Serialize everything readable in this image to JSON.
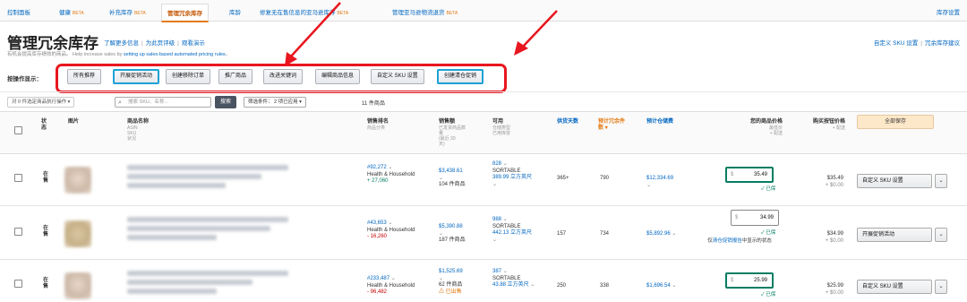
{
  "tabs": [
    {
      "label": "控制面板"
    },
    {
      "label": "健康",
      "badge": "BETA"
    },
    {
      "label": "补充库存",
      "badge": "BETA"
    },
    {
      "label": "管理冗余库存"
    },
    {
      "label": "库龄"
    },
    {
      "label": "修复无在售信息的亚马逊库存",
      "badge": "BETA"
    },
    {
      "label": "管理亚马逊物流退货",
      "badge": "BETA"
    }
  ],
  "tab_right": "库存设置",
  "header": {
    "title": "管理冗余库存",
    "links": [
      "了解更多信息",
      "为此页评级",
      "观看演示"
    ],
    "subtitle_prefix": "有机会提高库存绩效的商品。",
    "subtitle_mid": "Help increase sales by",
    "subtitle_link": "setting up sales-based automated pricing rules",
    "subtitle_end": "。",
    "right_links": [
      "自定义 SKU 设置",
      "冗余库存建议"
    ]
  },
  "actions": {
    "label": "按操作显示：",
    "buttons": [
      "所有推荐",
      "开展促销活动",
      "创建移除订单",
      "推广商品",
      "改进关键词",
      "编辑商品信息",
      "自定义 SKU 设置",
      "创建清仓促销"
    ]
  },
  "filters": {
    "selection": "对 0 件选定商品执行操作",
    "search_placeholder": "搜索 SKU、名称...",
    "search_button": "搜索",
    "condition": "筛选条件： 2 项已应用",
    "count": "11 件商品"
  },
  "table": {
    "save_all": "全部保存",
    "headers": {
      "status": "状态",
      "image": "图片",
      "name": "商品名称",
      "name_sub": [
        "ASIN",
        "SKU",
        "状况"
      ],
      "sales_rank": "销售排名",
      "sales_rank_sub": "商品分类",
      "sales": "销售额",
      "sales_sub": [
        "已发货商品数",
        "量",
        "(最近 30",
        "天)"
      ],
      "available": "可用",
      "available_sub": [
        "仓储类型",
        "已用库容"
      ],
      "days_supply": "供货天数",
      "est_excess": "预计冗余件数",
      "est_storage": "预计仓储费",
      "your_price": "您的商品价格",
      "your_price_sub": [
        "最低价",
        "+ 配送"
      ],
      "buybox": "购买按钮价格",
      "buybox_sub": "+ 配送"
    },
    "rows": [
      {
        "status": "在售",
        "rank": "#92,272",
        "category": "Health & Household",
        "rank_delta": "+ 27,060",
        "sales": "$3,438.61",
        "units": "104 件商品",
        "available": "828",
        "storage_type": "SORTABLE",
        "volume": "389.99 立方英尺",
        "days": "365+",
        "excess": "790",
        "fee": "$12,334.69",
        "currency": "$",
        "price": "35.49",
        "price_ok": "✓ 已保",
        "buybox": "$35.49",
        "shipping": "+ $0.00",
        "action": "自定义 SKU 设置"
      },
      {
        "status": "在售",
        "rank": "#43,653",
        "category": "Health & Household",
        "rank_delta": "- 16,260",
        "sales": "$5,390.88",
        "units": "187 件商品",
        "available": "988",
        "storage_type": "SORTABLE",
        "volume": "442.13 立方英尺",
        "days": "157",
        "excess": "734",
        "fee": "$5,892.96",
        "currency": "$",
        "price": "34.99",
        "price_ok": "✓ 已保",
        "note_prefix": "仅",
        "note_link": "清仓促销报告",
        "note_suffix": "中显示的状态",
        "buybox": "$34.99",
        "shipping": "+ $0.00",
        "action": "开展促销活动"
      },
      {
        "status": "在售",
        "rank": "#233,487",
        "category": "Health & Household",
        "rank_delta": "- 96,482",
        "sales": "$1,525.69",
        "units": "62 件商品",
        "units_warn": "⚠ 已出售",
        "available": "387",
        "storage_type": "SORTABLE",
        "volume": "43.88 立方英尺",
        "days": "250",
        "excess": "338",
        "fee": "$1,696.54",
        "currency": "$",
        "price": "25.99",
        "price_ok": "✓ 已保",
        "buybox": "$25.99",
        "shipping": "+ $0.00",
        "action": "自定义 SKU 设置"
      }
    ]
  },
  "colors": {
    "highlight_red": "#e8161f",
    "highlight_blue": "#1da1d6",
    "active_tab": "#c45500",
    "link": "#0066c0"
  }
}
